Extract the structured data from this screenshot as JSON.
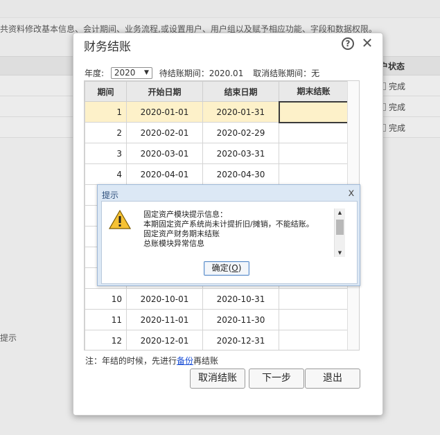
{
  "background": {
    "notice": "共资料修改基本信息、会计期间、业务流程,或设置用户、用户组以及赋予相应功能、字段和数据权限。",
    "status_header": "户状态",
    "status_rows": [
      "完成",
      "完成",
      "完成"
    ],
    "hint": "提示"
  },
  "dialog": {
    "title": "财务结账",
    "help_symbol": "?",
    "close_symbol": "✕",
    "year_label": "年度:",
    "year_value": "2020",
    "pending_label": "待结账期间：2020.01",
    "cancel_period_label": "取消结账期间：无",
    "columns": [
      "期间",
      "开始日期",
      "结束日期",
      "期末结账"
    ],
    "rows": [
      {
        "period": "1",
        "start": "2020-01-01",
        "end": "2020-01-31",
        "closed": ""
      },
      {
        "period": "2",
        "start": "2020-02-01",
        "end": "2020-02-29",
        "closed": ""
      },
      {
        "period": "3",
        "start": "2020-03-01",
        "end": "2020-03-31",
        "closed": ""
      },
      {
        "period": "4",
        "start": "2020-04-01",
        "end": "2020-04-30",
        "closed": ""
      },
      {
        "period": "",
        "start": "",
        "end": "",
        "closed": ""
      },
      {
        "period": "",
        "start": "",
        "end": "",
        "closed": ""
      },
      {
        "period": "",
        "start": "",
        "end": "",
        "closed": ""
      },
      {
        "period": "",
        "start": "",
        "end": "",
        "closed": ""
      },
      {
        "period": "",
        "start": "",
        "end": "",
        "closed": ""
      },
      {
        "period": "10",
        "start": "2020-10-01",
        "end": "2020-10-31",
        "closed": ""
      },
      {
        "period": "11",
        "start": "2020-11-01",
        "end": "2020-11-30",
        "closed": ""
      },
      {
        "period": "12",
        "start": "2020-12-01",
        "end": "2020-12-31",
        "closed": ""
      }
    ],
    "note_prefix": "注：年结的时候，先进行",
    "note_link": "备份",
    "note_suffix": "再结账",
    "btn_cancel": "取消结账",
    "btn_next": "下一步",
    "btn_exit": "退出"
  },
  "alert": {
    "title": "提示",
    "close_symbol": "x",
    "messages": [
      "固定资产模块提示信息：",
      "本期固定资产系统尚未计提折旧/摊销，不能结账。",
      "固定资产财务期末结账",
      "总账模块异常信息"
    ],
    "ok_label": "确定(",
    "ok_key": "O",
    "ok_label_end": ")"
  }
}
